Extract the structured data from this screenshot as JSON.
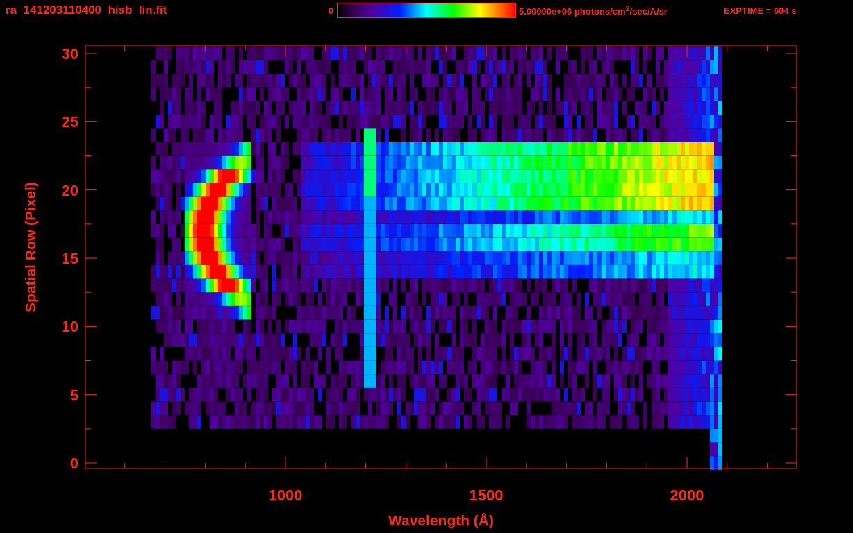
{
  "title": "ra_141203110400_hisb_lin.fit",
  "colorbar": {
    "min_label": "0",
    "max_label": "5.00000e+06 photons/cm$^{2}$/sec/A/sr"
  },
  "exposure": "EXPTIME = 604 s",
  "y_axis": {
    "label": "Spatial Row (Pixel)",
    "ticks": [
      "30",
      "25",
      "20",
      "15",
      "10",
      "5",
      "0"
    ]
  },
  "x_axis": {
    "label": "Wavelength (Å)",
    "ticks": [
      "1000",
      "1500",
      "2000"
    ]
  }
}
